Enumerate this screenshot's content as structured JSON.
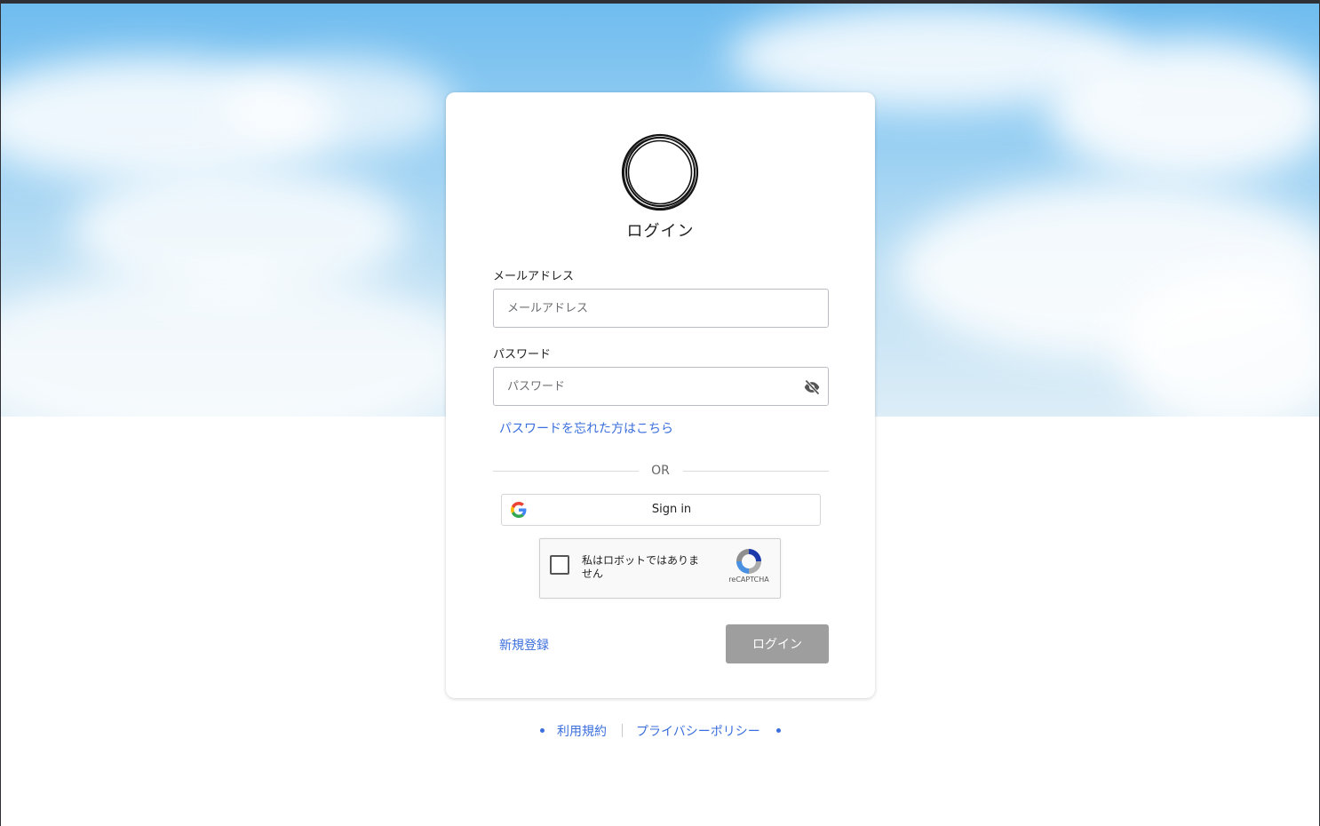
{
  "login": {
    "title": "ログイン",
    "email": {
      "label": "メールアドレス",
      "placeholder": "メールアドレス"
    },
    "password": {
      "label": "パスワード",
      "placeholder": "パスワード"
    },
    "forgot_link": "パスワードを忘れた方はこちら",
    "divider": "OR",
    "google_button": "Sign in",
    "captcha": {
      "text": "私はロボットではありません",
      "brand": "reCAPTCHA"
    },
    "register_link": "新規登録",
    "submit_button": "ログイン"
  },
  "footer": {
    "terms": "利用規約",
    "privacy": "プライバシーポリシー"
  },
  "colors": {
    "link": "#3b6fdc",
    "disabled_button": "#9e9e9e",
    "sky": "#7cc2f0"
  },
  "icons": [
    "logo-circle-icon",
    "eye-off-icon",
    "google-g-icon",
    "recaptcha-icon"
  ]
}
